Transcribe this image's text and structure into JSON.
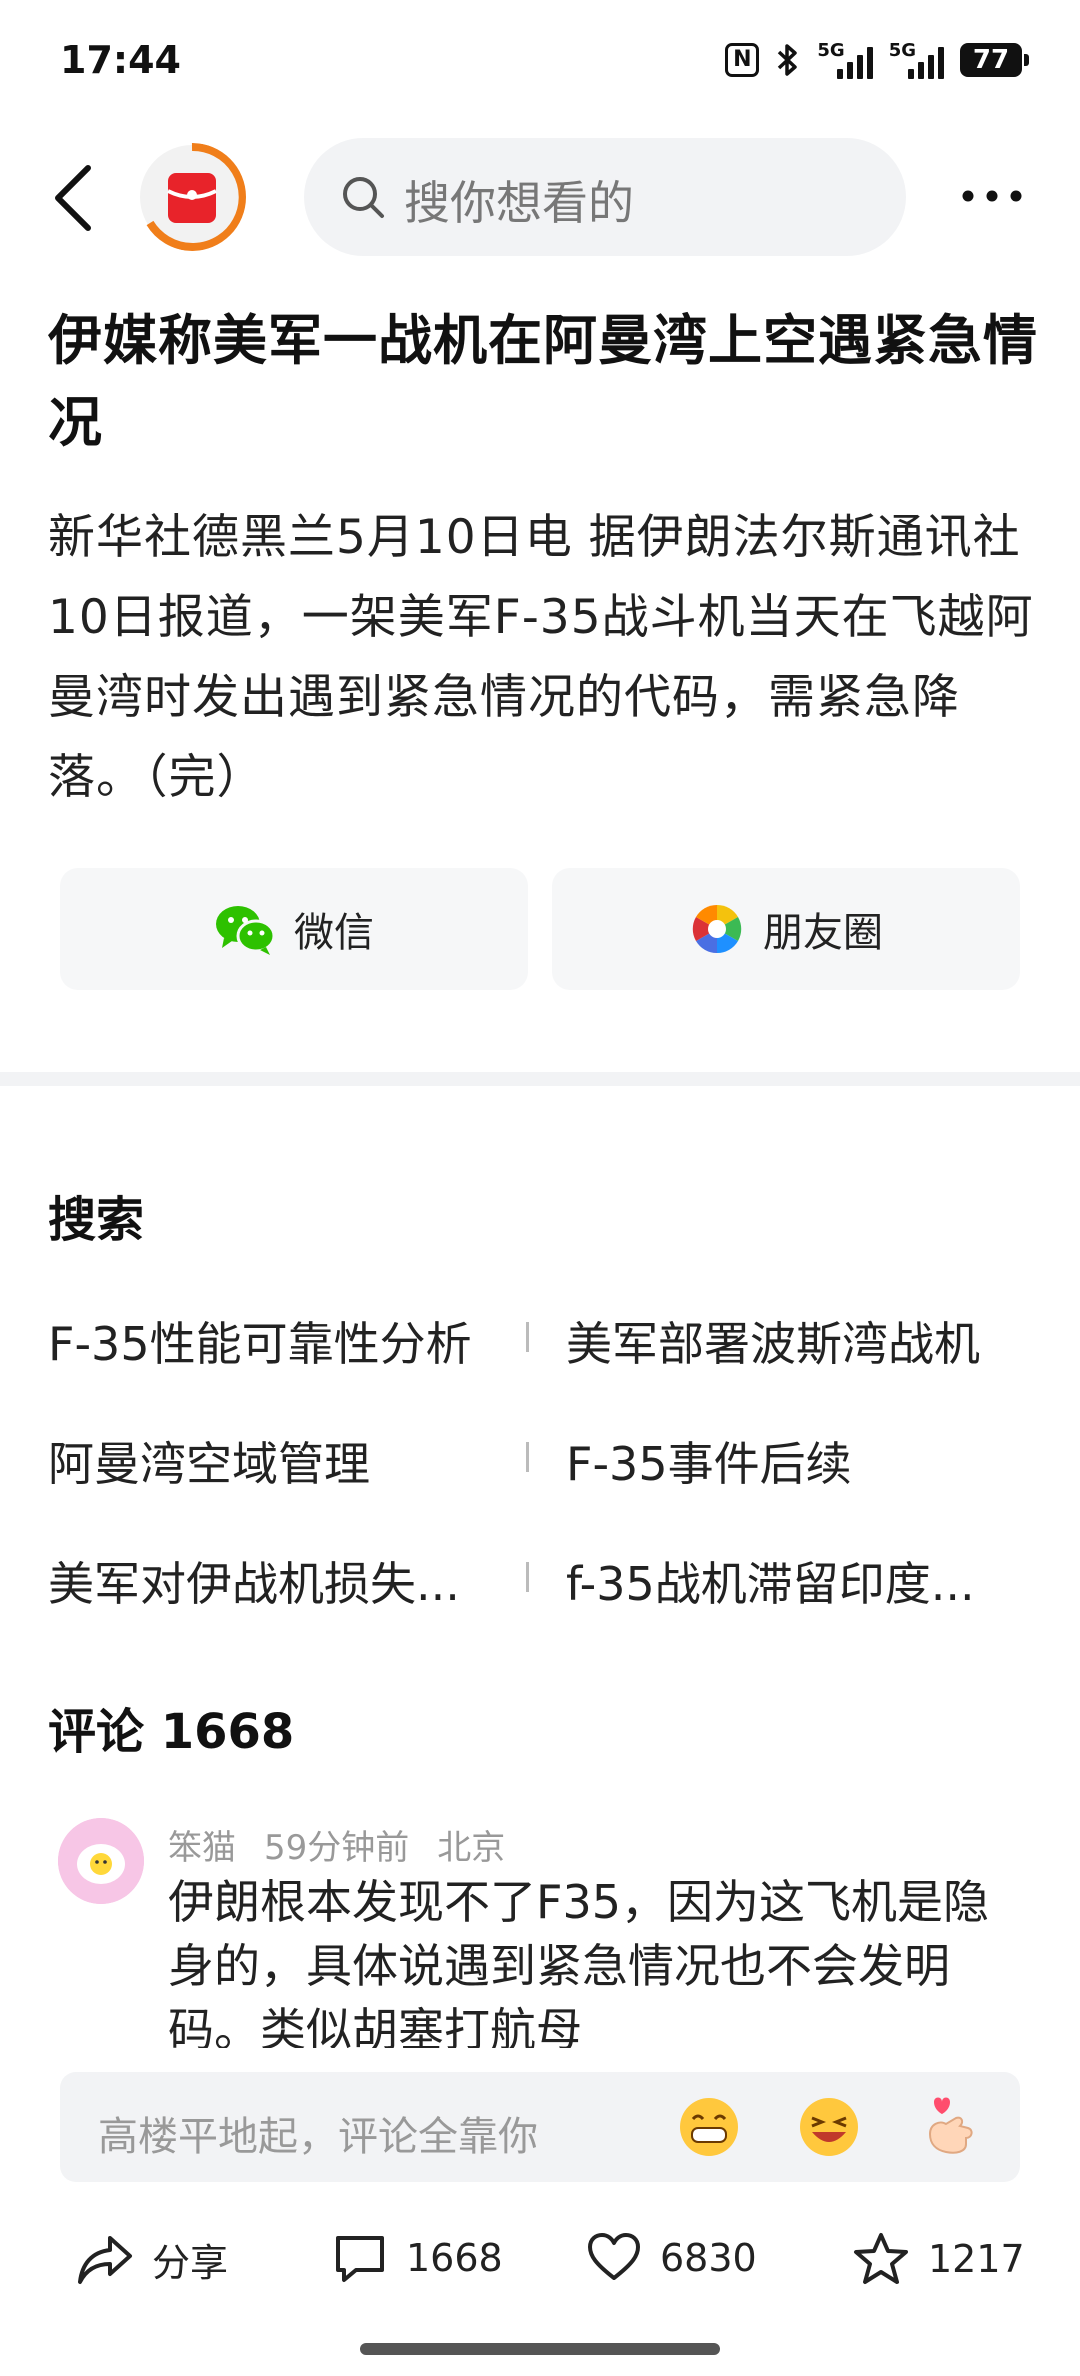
{
  "status": {
    "time": "17:44",
    "net1": "5G",
    "net2": "5G",
    "battery": "77"
  },
  "header": {
    "search_placeholder": "搜你想看的",
    "icons": [
      "back-icon",
      "app-logo",
      "search-icon",
      "more-icon"
    ]
  },
  "article": {
    "headline": "伊媒称美军一战机在阿曼湾上空遇紧急情况",
    "body": "新华社德黑兰5月10日电 据伊朗法尔斯通讯社10日报道，一架美军F-35战斗机当天在飞越阿曼湾时发出遇到紧急情况的代码，需紧急降落。（完）"
  },
  "share": {
    "wechat": "微信",
    "moments": "朋友圈"
  },
  "search_section": {
    "title": "搜索",
    "items": [
      "F-35性能可靠性分析",
      "美军部署波斯湾战机",
      "阿曼湾空域管理",
      "F-35事件后续",
      "美军对伊战机损失...",
      "f-35战机滞留印度..."
    ]
  },
  "comments": {
    "title": "评论 1668",
    "first": {
      "user": "笨猫",
      "time": "59分钟前",
      "location": "北京",
      "text": "伊朗根本发现不了F35，因为这飞机是隐身的，具体说遇到紧急情况也不会发明码。类似胡塞打航母"
    },
    "input_placeholder": "高楼平地起，评论全靠你"
  },
  "actions": {
    "share": "分享",
    "comments": "1668",
    "likes": "6830",
    "favorites": "1217"
  },
  "colors": {
    "accent_orange": "#f07e1a",
    "wechat_green": "#2dc100",
    "logo_red": "#e8232a"
  }
}
